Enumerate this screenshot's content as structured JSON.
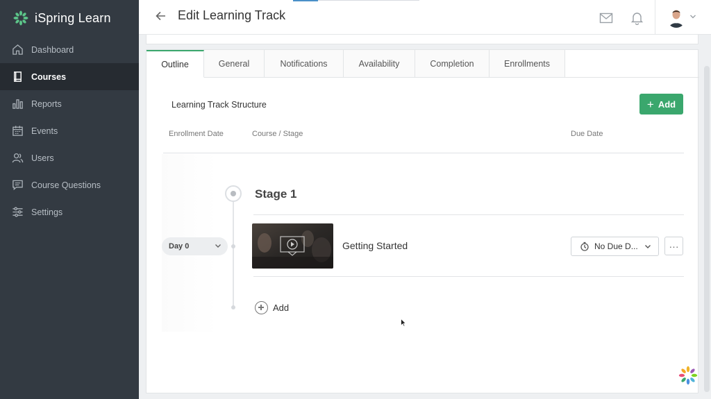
{
  "app": {
    "name": "iSpring Learn"
  },
  "sidebar": {
    "items": [
      {
        "label": "Dashboard",
        "icon": "home-icon",
        "active": false
      },
      {
        "label": "Courses",
        "icon": "book-icon",
        "active": true
      },
      {
        "label": "Reports",
        "icon": "bar-chart-icon",
        "active": false
      },
      {
        "label": "Events",
        "icon": "calendar-icon",
        "active": false
      },
      {
        "label": "Users",
        "icon": "users-icon",
        "active": false
      },
      {
        "label": "Course Questions",
        "icon": "comment-icon",
        "active": false
      },
      {
        "label": "Settings",
        "icon": "sliders-icon",
        "active": false
      }
    ]
  },
  "header": {
    "title": "Edit Learning Track",
    "icons": [
      "back-arrow-icon",
      "mail-icon",
      "bell-icon",
      "avatar",
      "chevron-down-icon"
    ]
  },
  "tabs": [
    {
      "label": "Outline",
      "active": true
    },
    {
      "label": "General",
      "active": false
    },
    {
      "label": "Notifications",
      "active": false
    },
    {
      "label": "Availability",
      "active": false
    },
    {
      "label": "Completion",
      "active": false
    },
    {
      "label": "Enrollments",
      "active": false
    }
  ],
  "structure": {
    "title": "Learning Track Structure",
    "add_label": "Add",
    "columns": {
      "enrollment_date": "Enrollment Date",
      "course_stage": "Course / Stage",
      "due_date": "Due Date"
    },
    "stage": {
      "title": "Stage 1",
      "course": {
        "day": "Day 0",
        "title": "Getting Started",
        "due": "No Due D...",
        "more": "···"
      },
      "add_label": "Add"
    }
  },
  "colors": {
    "sidebar_bg": "#333a42",
    "sidebar_active_bg": "#262b31",
    "accent_green": "#3aa76d"
  }
}
